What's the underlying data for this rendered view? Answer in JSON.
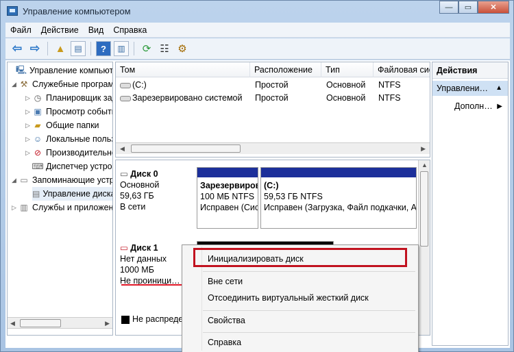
{
  "window": {
    "title": "Управление компьютером",
    "buttons": {
      "minimize": "—",
      "maximize": "▭",
      "close": "✕"
    }
  },
  "menu": [
    "Файл",
    "Действие",
    "Вид",
    "Справка"
  ],
  "tree": {
    "items": [
      {
        "label": "Управление компьютером (локальным)",
        "icon": "computer-icon"
      },
      {
        "label": "Служебные программы",
        "icon": "tools-icon"
      },
      {
        "label": "Планировщик заданий",
        "icon": "clock-icon"
      },
      {
        "label": "Просмотр событий",
        "icon": "event-viewer-icon"
      },
      {
        "label": "Общие папки",
        "icon": "shared-folder-icon"
      },
      {
        "label": "Локальные пользователи",
        "icon": "users-icon"
      },
      {
        "label": "Производительность",
        "icon": "performance-icon"
      },
      {
        "label": "Диспетчер устройств",
        "icon": "device-manager-icon"
      },
      {
        "label": "Запоминающие устройства",
        "icon": "storage-icon"
      },
      {
        "label": "Управление дисками",
        "icon": "disk-management-icon"
      },
      {
        "label": "Службы и приложения",
        "icon": "services-icon"
      }
    ]
  },
  "list": {
    "columns": [
      "Том",
      "Расположение",
      "Тип",
      "Файловая система"
    ],
    "rows": [
      {
        "volume": "(C:)",
        "layout": "Простой",
        "type": "Основной",
        "fs": "NTFS"
      },
      {
        "volume": "Зарезервировано системой",
        "layout": "Простой",
        "type": "Основной",
        "fs": "NTFS"
      }
    ]
  },
  "disks": {
    "disk0": {
      "name": "Диск 0",
      "type": "Основной",
      "size": "59,63 ГБ",
      "status": "В сети",
      "partitions": [
        {
          "name": "Зарезервировано системой",
          "size": "100 МБ NTFS",
          "state": "Исправен (Система, Активен, Основной раздел)"
        },
        {
          "name": "(C:)",
          "size": "59,53 ГБ NTFS",
          "state": "Исправен (Загрузка, Файл подкачки, Аварийный дамп, Основной раздел)"
        }
      ]
    },
    "disk1": {
      "name": "Диск 1",
      "type": "Нет данных",
      "size": "1000 МБ",
      "status": "Не проинициализирован"
    },
    "legend": "Не распределена"
  },
  "actions": {
    "title": "Действия",
    "section": "Управление дисками",
    "more": "Дополнительные действия"
  },
  "context_menu": {
    "items": [
      "Инициализировать диск",
      "Вне сети",
      "Отсоединить виртуальный жесткий диск",
      "Свойства",
      "Справка"
    ]
  },
  "colors": {
    "highlight": "#c1121f",
    "primary_partition": "#1c2f9a",
    "unallocated": "#000000"
  }
}
